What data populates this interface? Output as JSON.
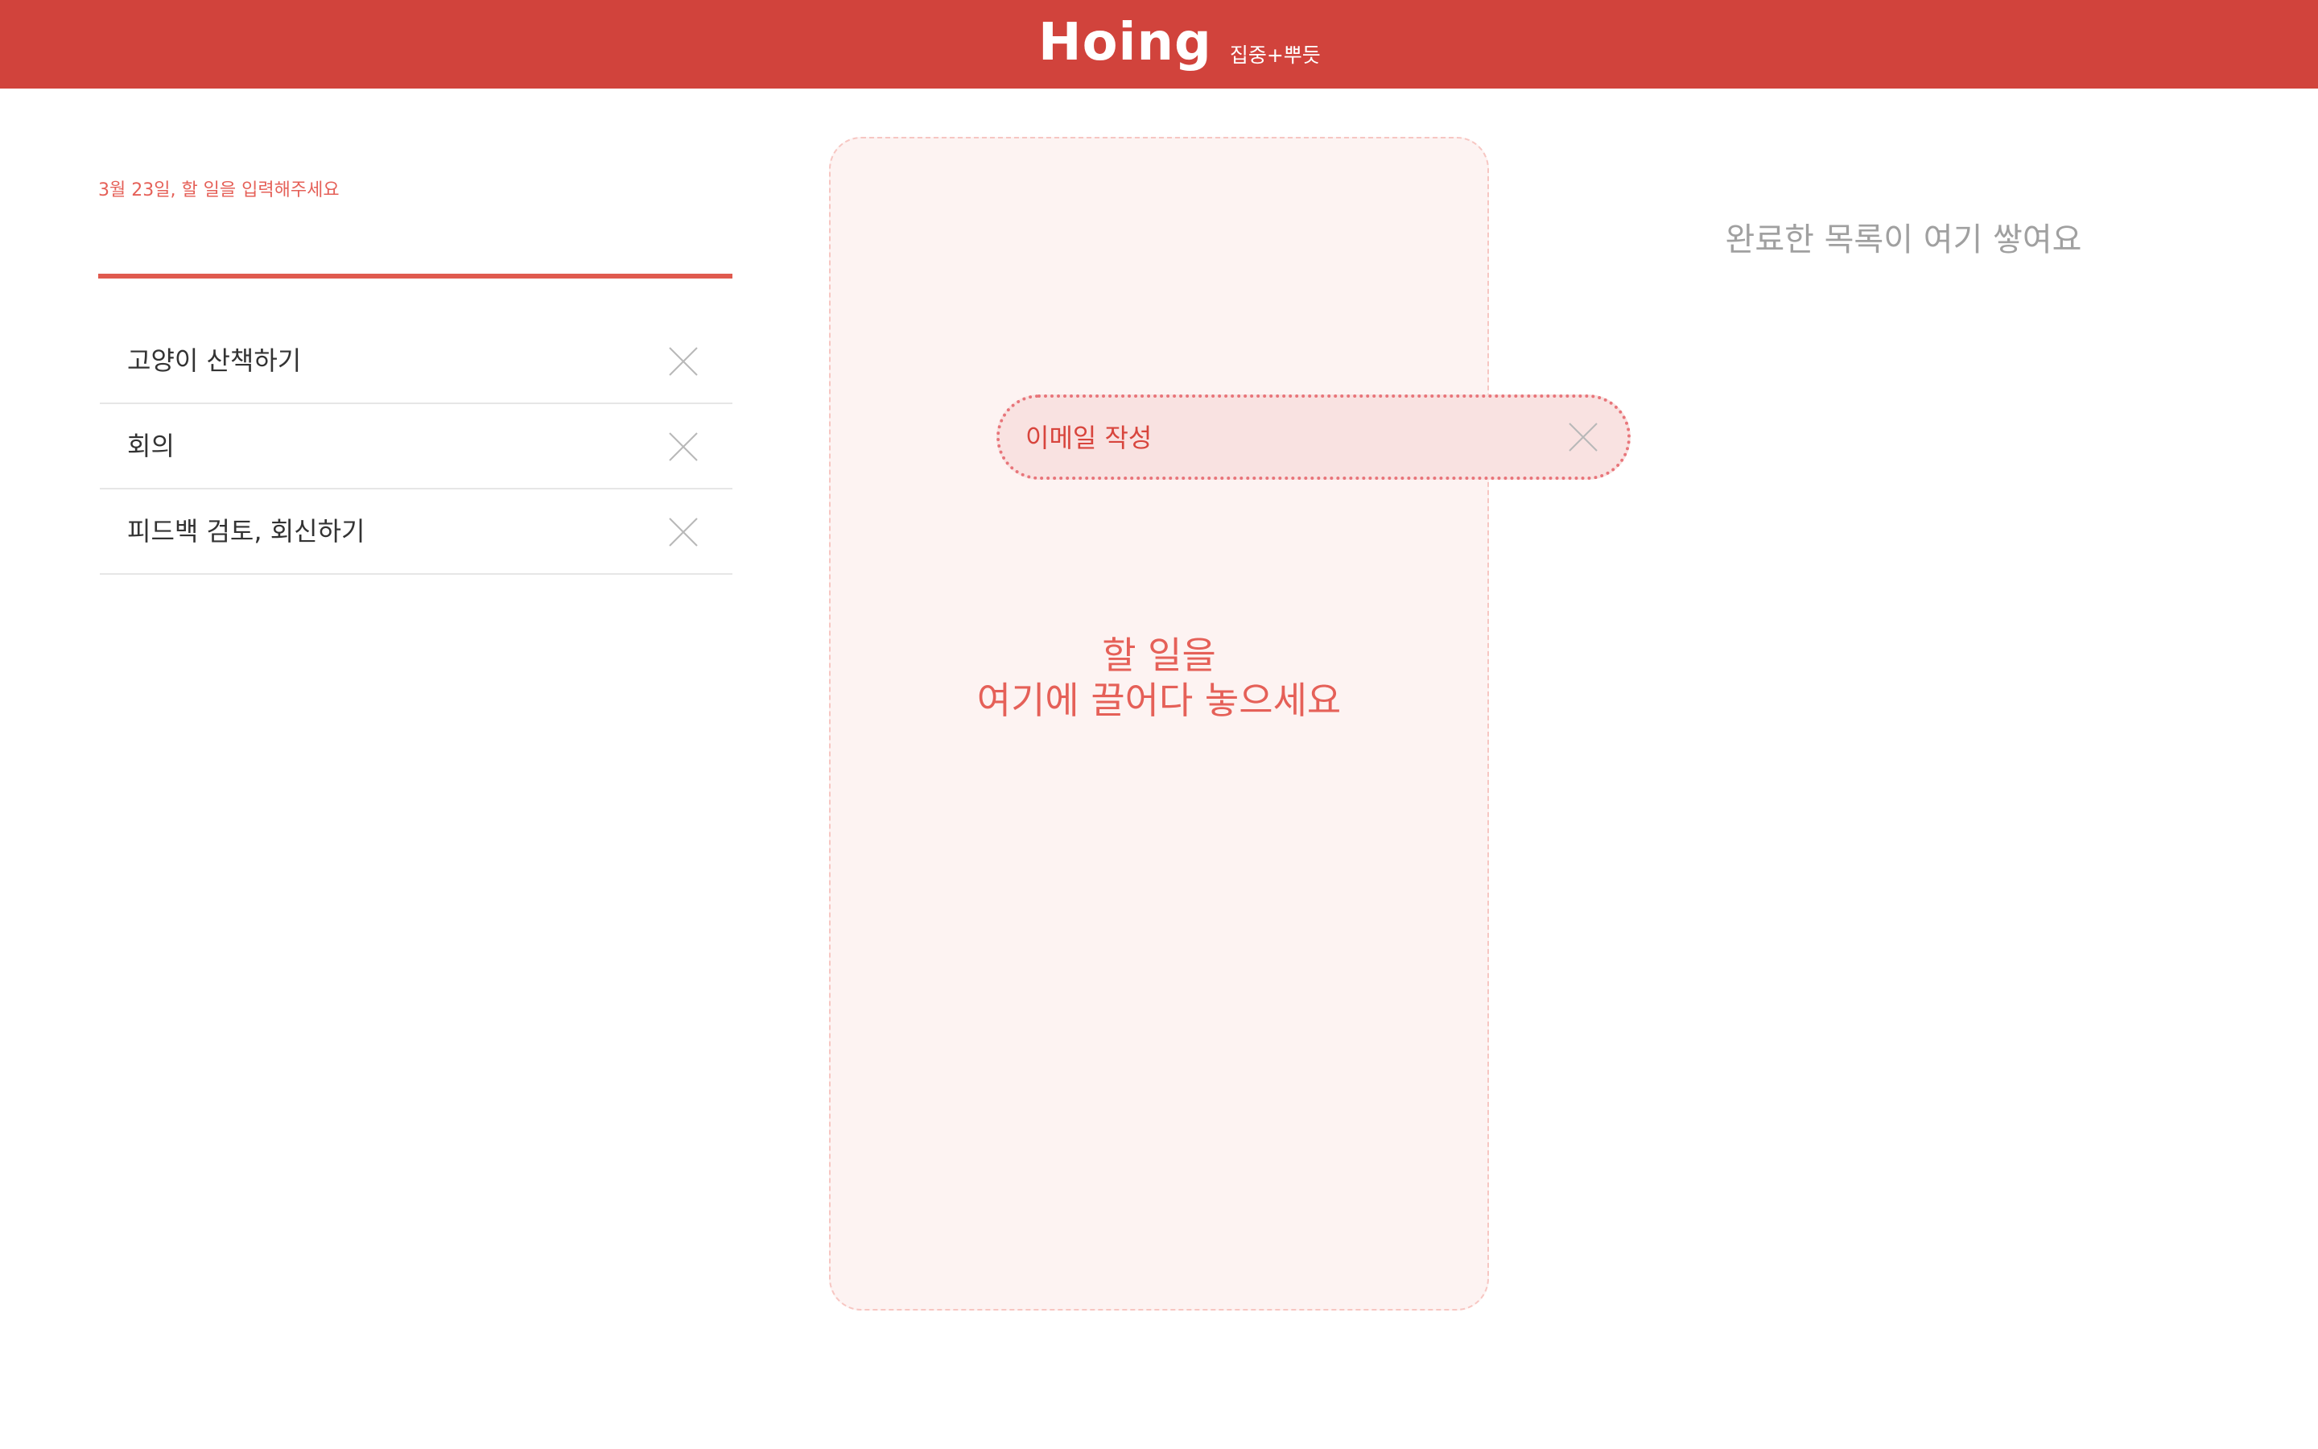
{
  "header": {
    "logo": "Hoing",
    "tagline": "집중+뿌듯",
    "background": "#d1433c"
  },
  "input": {
    "label": "3월 23일, 할 일을 입력해주세요",
    "value": ""
  },
  "todos": [
    {
      "text": "고양이 산책하기"
    },
    {
      "text": "회의"
    },
    {
      "text": "피드백 검토, 회신하기"
    }
  ],
  "drop_zone": {
    "line1": "할 일을",
    "line2": "여기에 끌어다 놓으세요"
  },
  "dragging_item": {
    "text": "이메일 작성"
  },
  "done": {
    "empty_text": "완료한 목록이 여기 쌓여요"
  },
  "icons": {
    "close": "close-icon"
  },
  "colors": {
    "accent": "#e05a4f",
    "drop_bg": "#fdf3f2",
    "drag_bg": "#f9e2e1",
    "muted": "#a0a0a0"
  }
}
